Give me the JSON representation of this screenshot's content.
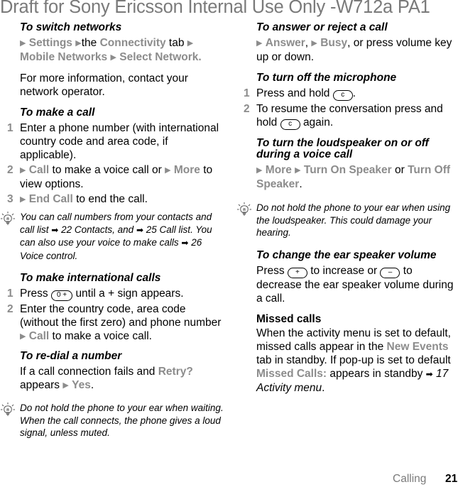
{
  "header": {
    "draft_notice": "Draft for Sony Ericsson Internal Use Only -W712a PA1"
  },
  "left_column": {
    "switch_networks": {
      "heading": "To switch networks",
      "path": [
        "Settings",
        "the",
        "Connectivity",
        "tab",
        "Mobile Networks",
        "Select Network."
      ],
      "more_info": "For more information, contact your network operator."
    },
    "make_call": {
      "heading": "To make a call",
      "steps": [
        {
          "num": "1",
          "text": "Enter a phone number (with international country code and area code, if applicable)."
        },
        {
          "num": "2",
          "menu1": "Call",
          "text1": "to make a voice call or",
          "menu2": "More",
          "text2": "to view options."
        },
        {
          "num": "3",
          "menu1": "End Call",
          "text1": "to end the call."
        }
      ]
    },
    "tip1": {
      "icon": "lightbulb-icon",
      "text1": "You can call numbers from your contacts and call list",
      "ref1": "22 Contacts",
      "text2": ", and",
      "ref2": "25 Call list",
      "text3": ". You can also use your voice to make calls",
      "ref3": "26 Voice control",
      "text4": "."
    },
    "international": {
      "heading": "To make international calls",
      "steps": [
        {
          "num": "1",
          "pre": "Press",
          "key": "0 +",
          "post": "until a + sign appears."
        },
        {
          "num": "2",
          "text": "Enter the country code, area code (without the first zero) and phone number",
          "menu": "Call",
          "post": "to make a voice call."
        }
      ]
    },
    "redial": {
      "heading": "To re-dial a number",
      "text1": "If a call connection fails and",
      "menu1": "Retry?",
      "text2": "appears",
      "menu2": "Yes",
      "text3": "."
    },
    "tip2": {
      "icon": "lightbulb-icon",
      "text": "Do not hold the phone to your ear when waiting. When the call connects, the phone gives a loud signal, unless muted."
    }
  },
  "right_column": {
    "answer": {
      "heading": "To answer or reject a call",
      "menu1": "Answer",
      "menu2": "Busy",
      "text": ", or press volume key up or down."
    },
    "microphone": {
      "heading": "To turn off the microphone",
      "steps": [
        {
          "num": "1",
          "pre": "Press and hold",
          "key": "c",
          "post": "."
        },
        {
          "num": "2",
          "pre": "To resume the conversation press and hold",
          "key": "c",
          "post": "again."
        }
      ]
    },
    "loudspeaker": {
      "heading": "To turn the loudspeaker on or off during a voice call",
      "menu1": "More",
      "menu2": "Turn On Speaker",
      "or": "or",
      "menu3": "Turn Off Speaker",
      "end": "."
    },
    "tip3": {
      "icon": "lightbulb-icon",
      "text": "Do not hold the phone to your ear when using the loudspeaker. This could damage your hearing."
    },
    "volume": {
      "heading": "To change the ear speaker volume",
      "pre": "Press",
      "key_plus": "+",
      "mid": "to increase or",
      "key_minus": "–",
      "post": "to decrease the ear speaker volume during a call."
    },
    "missed": {
      "heading": "Missed calls",
      "text1": "When the activity menu is set to default, missed calls appear in the",
      "menu1": "New Events",
      "text2": "tab in standby. If pop-up is set to default",
      "menu2": "Missed Calls:",
      "text3": "appears in standby",
      "ref": "17 Activity menu",
      "text4": "."
    }
  },
  "footer": {
    "section": "Calling",
    "page": "21"
  },
  "icons": {
    "arrow": "▶",
    "ref_arrow": "➜"
  }
}
